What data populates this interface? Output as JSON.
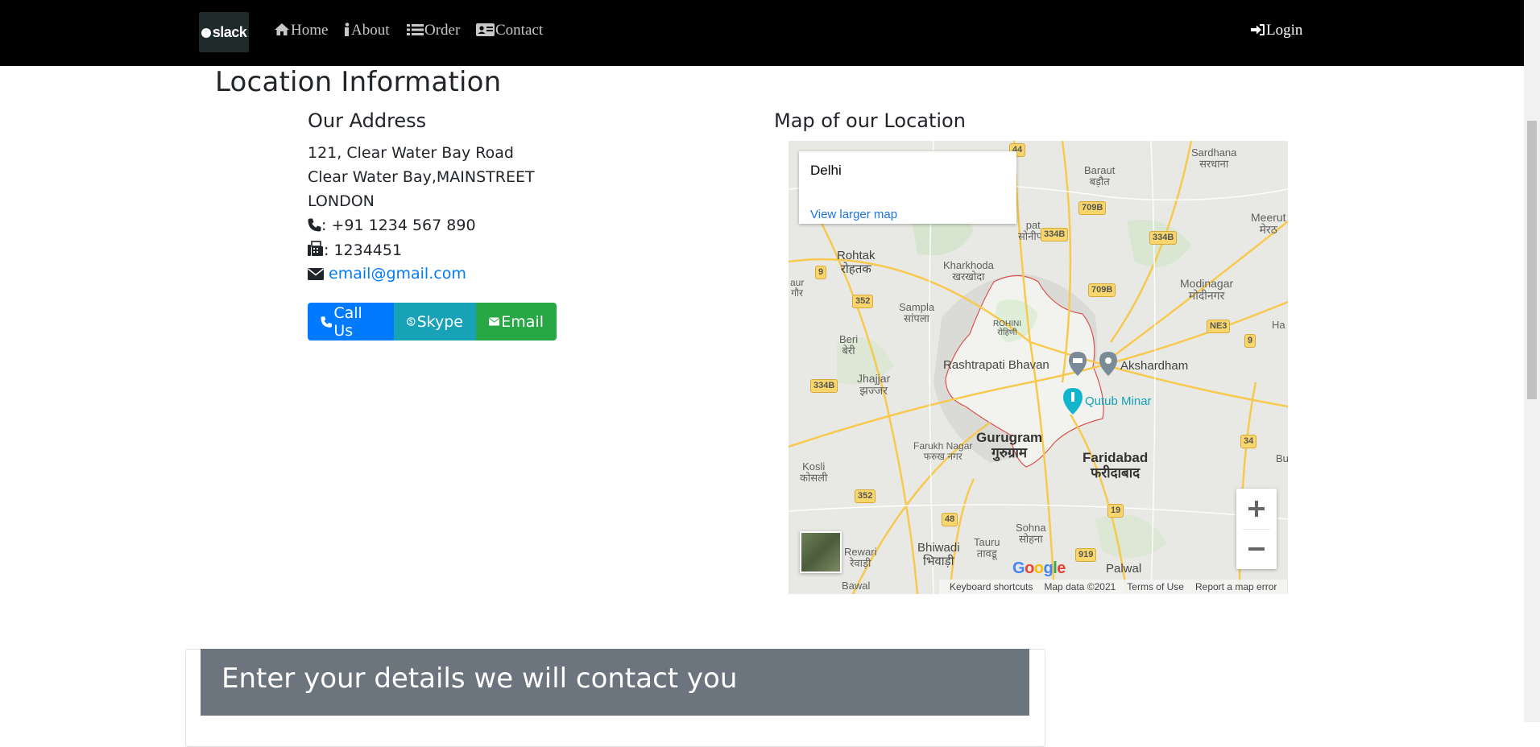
{
  "nav": {
    "brand": "slack",
    "items": [
      {
        "label": "Home",
        "icon": "home-icon"
      },
      {
        "label": "About",
        "icon": "info-icon"
      },
      {
        "label": "Order",
        "icon": "list-icon"
      },
      {
        "label": "Contact",
        "icon": "address-card-icon"
      }
    ],
    "login": "Login"
  },
  "page": {
    "title": "Location Information",
    "address_heading": "Our Address",
    "map_heading": "Map of our Location"
  },
  "address": {
    "line1": "121, Clear Water Bay Road",
    "line2": "Clear Water Bay,MAINSTREET",
    "line3": "LONDON",
    "phone": ": +91 1234 567 890",
    "fax": ": 1234451",
    "email": "email@gmail.com"
  },
  "buttons": {
    "call": "Call Us",
    "skype": "Skype",
    "email": "Email"
  },
  "map": {
    "place": "Delhi",
    "view_larger": "View larger map",
    "keyboard_shortcuts": "Keyboard shortcuts",
    "map_data": "Map data ©2021",
    "terms": "Terms of Use",
    "report": "Report a map error",
    "google": "Google",
    "labels": {
      "sardhana": "Sardhana\nसरधाना",
      "baraut": "Baraut\nबड़ौत",
      "meerut": "Meerut\nमेरठ",
      "rohtak": "Rohtak\nरोहतक",
      "kharkhoda": "Kharkhoda\nखरखोदा",
      "modinagar": "Modinagar\nमोदीनगर",
      "sampla": "Sampla\nसांपला",
      "rohini": "ROHINI\nरोहिणी",
      "beri": "Beri\nबेरी",
      "rashtrapati": "Rashtrapati Bhavan",
      "akshardham": "Akshardham",
      "jhajjar": "Jhajjar\nझज्जर",
      "qutub": "Qutub Minar",
      "gurugram": "Gurugram\nगुरुग्राम",
      "faridabad": "Faridabad\nफरीदाबाद",
      "farukh": "Farukh Nagar\nफरुख नगर",
      "kosli": "Kosli\nकोसली",
      "sohna": "Sohna\nसोहना",
      "rewari": "Rewari\nरेवाड़ी",
      "bhiwadi": "Bhiwadi\nभिवाड़ी",
      "tauru": "Tauru\nतावडू",
      "palwal": "Palwal",
      "bawal": "Bawal",
      "sonipat_frag": "pat\nसोनीपत",
      "ha_frag": "Ha",
      "bu_frag": "Bu",
      "aur_frag": "aur\nगौर"
    },
    "shields": [
      "44",
      "709B",
      "334B",
      "334B",
      "9",
      "709B",
      "352",
      "NE3",
      "9",
      "334B",
      "34",
      "352",
      "19",
      "48",
      "919"
    ]
  },
  "contact_card": {
    "title": "Enter your details we will contact you"
  }
}
